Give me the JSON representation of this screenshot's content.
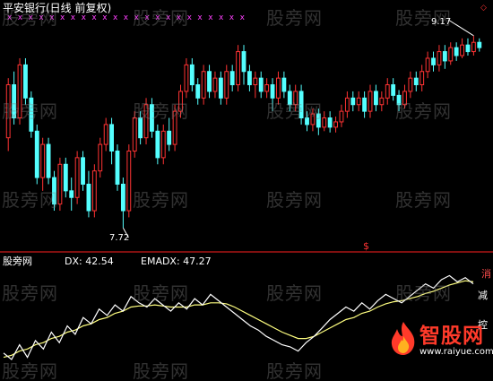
{
  "app": {
    "title": "平安银行(日线 前复权)",
    "watermark": "股旁网"
  },
  "price_panel": {
    "high_marker": "9.17",
    "low_marker": "7.72",
    "signal_symbol": "$",
    "corner_symbol": "◇"
  },
  "indicator_panel": {
    "name": "股旁网",
    "dx_text": "DX: 42.54",
    "emadx_text": "EMADX: 47.27",
    "side_labels": [
      "消",
      "减",
      "控"
    ]
  },
  "logo": {
    "main": "智股网",
    "sub": "www.raiyue.com"
  },
  "colors": {
    "background": "#000000",
    "up_candle": "#ff3333",
    "down_candle": "#54ffff",
    "separator": "#ff2020",
    "dx_line": "#ffffff",
    "emadx_line": "#ffff80",
    "marker": "#ff40ff"
  },
  "chart_data": {
    "type": "candlestick",
    "price_range": [
      7.6,
      9.25
    ],
    "markers_top": "x",
    "candles": [
      [
        8.4,
        8.8,
        8.85,
        8.3
      ],
      [
        8.8,
        8.55,
        8.9,
        8.5
      ],
      [
        8.55,
        8.95,
        9.0,
        8.5
      ],
      [
        8.95,
        8.7,
        9.0,
        8.65
      ],
      [
        8.7,
        8.45,
        8.75,
        8.4
      ],
      [
        8.45,
        8.1,
        8.5,
        8.05
      ],
      [
        8.1,
        8.35,
        8.4,
        8.0
      ],
      [
        8.35,
        8.1,
        8.4,
        8.05
      ],
      [
        8.1,
        7.9,
        8.15,
        7.85
      ],
      [
        7.9,
        8.2,
        8.25,
        7.85
      ],
      [
        8.2,
        8.0,
        8.25,
        7.95
      ],
      [
        8.0,
        7.95,
        8.1,
        7.85
      ],
      [
        7.95,
        8.25,
        8.3,
        7.9
      ],
      [
        8.25,
        8.05,
        8.3,
        8.0
      ],
      [
        8.05,
        7.85,
        8.15,
        7.8
      ],
      [
        7.85,
        8.15,
        8.2,
        7.8
      ],
      [
        8.15,
        8.35,
        8.4,
        8.1
      ],
      [
        8.35,
        8.5,
        8.55,
        8.3
      ],
      [
        8.5,
        8.3,
        8.55,
        8.2
      ],
      [
        8.3,
        8.05,
        8.35,
        8.0
      ],
      [
        8.05,
        7.85,
        8.1,
        7.72
      ],
      [
        7.85,
        8.3,
        8.35,
        7.8
      ],
      [
        8.3,
        8.55,
        8.6,
        8.25
      ],
      [
        8.55,
        8.4,
        8.6,
        8.35
      ],
      [
        8.4,
        8.65,
        8.7,
        8.35
      ],
      [
        8.65,
        8.45,
        8.7,
        8.4
      ],
      [
        8.45,
        8.25,
        8.5,
        8.2
      ],
      [
        8.25,
        8.45,
        8.5,
        8.2
      ],
      [
        8.45,
        8.35,
        8.55,
        8.3
      ],
      [
        8.35,
        8.6,
        8.65,
        8.3
      ],
      [
        8.6,
        8.75,
        8.8,
        8.55
      ],
      [
        8.75,
        8.95,
        9.0,
        8.7
      ],
      [
        8.95,
        8.8,
        9.0,
        8.75
      ],
      [
        8.8,
        8.7,
        8.85,
        8.65
      ],
      [
        8.7,
        8.9,
        8.95,
        8.65
      ],
      [
        8.9,
        8.75,
        8.95,
        8.7
      ],
      [
        8.75,
        8.85,
        8.9,
        8.7
      ],
      [
        8.85,
        8.7,
        8.9,
        8.65
      ],
      [
        8.7,
        8.9,
        8.95,
        8.65
      ],
      [
        8.9,
        8.8,
        8.95,
        8.75
      ],
      [
        8.8,
        9.05,
        9.1,
        8.75
      ],
      [
        9.05,
        8.9,
        9.1,
        8.8
      ],
      [
        8.9,
        8.8,
        8.95,
        8.75
      ],
      [
        8.8,
        8.85,
        8.9,
        8.7
      ],
      [
        8.85,
        8.75,
        8.9,
        8.7
      ],
      [
        8.75,
        8.8,
        8.85,
        8.7
      ],
      [
        8.8,
        8.7,
        8.85,
        8.6
      ],
      [
        8.7,
        8.85,
        8.9,
        8.65
      ],
      [
        8.85,
        8.75,
        8.9,
        8.7
      ],
      [
        8.75,
        8.65,
        8.8,
        8.6
      ],
      [
        8.65,
        8.75,
        8.8,
        8.6
      ],
      [
        8.75,
        8.55,
        8.8,
        8.5
      ],
      [
        8.55,
        8.5,
        8.6,
        8.45
      ],
      [
        8.5,
        8.58,
        8.62,
        8.45
      ],
      [
        8.58,
        8.48,
        8.62,
        8.42
      ],
      [
        8.48,
        8.55,
        8.6,
        8.45
      ],
      [
        8.55,
        8.48,
        8.6,
        8.44
      ],
      [
        8.48,
        8.52,
        8.56,
        8.44
      ],
      [
        8.52,
        8.6,
        8.65,
        8.48
      ],
      [
        8.6,
        8.7,
        8.75,
        8.55
      ],
      [
        8.7,
        8.65,
        8.75,
        8.6
      ],
      [
        8.65,
        8.7,
        8.75,
        8.6
      ],
      [
        8.7,
        8.6,
        8.75,
        8.55
      ],
      [
        8.6,
        8.75,
        8.8,
        8.55
      ],
      [
        8.75,
        8.65,
        8.8,
        8.6
      ],
      [
        8.65,
        8.7,
        8.75,
        8.6
      ],
      [
        8.7,
        8.8,
        8.85,
        8.65
      ],
      [
        8.8,
        8.72,
        8.85,
        8.68
      ],
      [
        8.72,
        8.65,
        8.76,
        8.6
      ],
      [
        8.65,
        8.75,
        8.8,
        8.62
      ],
      [
        8.75,
        8.85,
        8.9,
        8.7
      ],
      [
        8.85,
        8.8,
        8.9,
        8.75
      ],
      [
        8.8,
        8.9,
        8.95,
        8.75
      ],
      [
        8.9,
        9.0,
        9.05,
        8.85
      ],
      [
        9.0,
        8.95,
        9.05,
        8.9
      ],
      [
        8.95,
        9.05,
        9.1,
        8.9
      ],
      [
        9.05,
        8.98,
        9.1,
        8.92
      ],
      [
        8.98,
        9.08,
        9.12,
        8.95
      ],
      [
        9.08,
        9.02,
        9.12,
        8.98
      ],
      [
        9.02,
        9.1,
        9.15,
        9.0
      ],
      [
        9.1,
        9.05,
        9.15,
        9.02
      ],
      [
        9.05,
        9.12,
        9.17,
        9.02
      ],
      [
        9.12,
        9.08,
        9.15,
        9.05
      ]
    ],
    "indicator_range": [
      0,
      100
    ],
    "dx": [
      18,
      12,
      26,
      14,
      30,
      22,
      38,
      28,
      44,
      36,
      52,
      46,
      60,
      54,
      64,
      58,
      72,
      66,
      62,
      70,
      64,
      58,
      66,
      60,
      70,
      64,
      74,
      68,
      62,
      56,
      50,
      44,
      40,
      34,
      30,
      26,
      24,
      20,
      28,
      34,
      42,
      50,
      56,
      62,
      58,
      66,
      60,
      68,
      74,
      70,
      66,
      72,
      78,
      84,
      80,
      88,
      92,
      86,
      90,
      84
    ],
    "emadx": [
      14,
      16,
      20,
      22,
      26,
      28,
      32,
      34,
      38,
      40,
      44,
      46,
      50,
      52,
      56,
      58,
      62,
      63,
      63,
      64,
      63,
      62,
      62,
      62,
      64,
      64,
      66,
      66,
      65,
      62,
      58,
      54,
      50,
      46,
      42,
      38,
      35,
      32,
      32,
      34,
      38,
      42,
      46,
      50,
      52,
      56,
      58,
      62,
      65,
      67,
      68,
      70,
      72,
      75,
      77,
      80,
      83,
      85,
      87,
      86
    ]
  }
}
